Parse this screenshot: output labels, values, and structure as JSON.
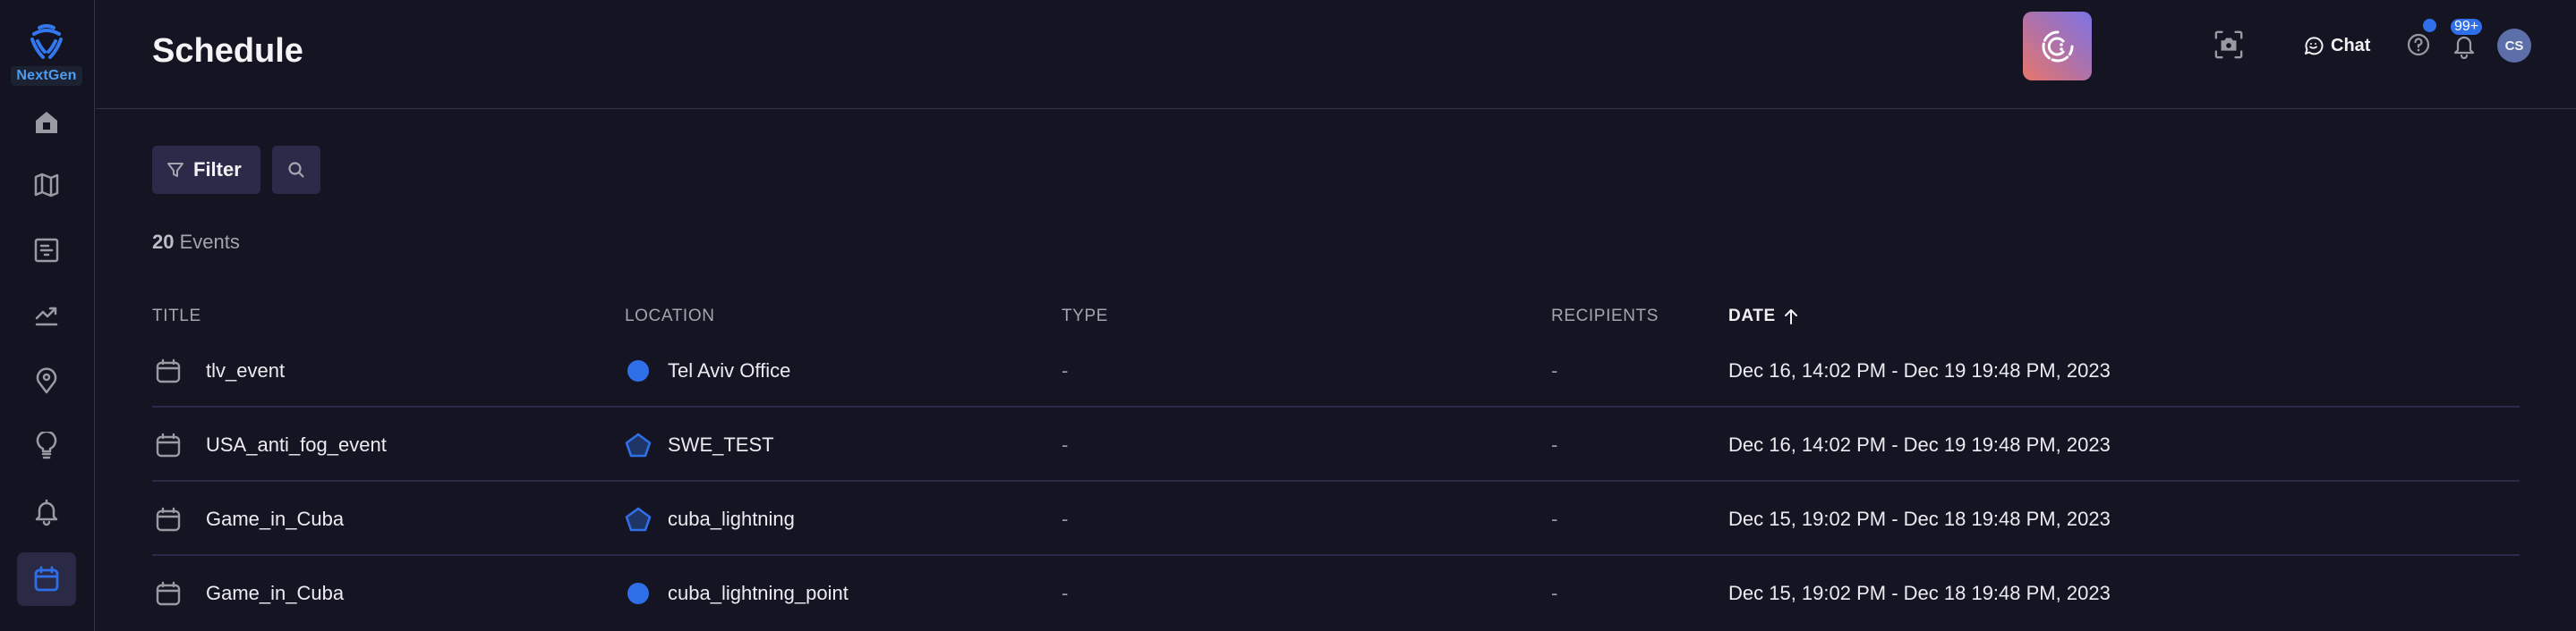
{
  "app": {
    "brand": "NextGen"
  },
  "sidebar": {
    "items": [
      {
        "name": "home",
        "icon": "home-icon",
        "active": false
      },
      {
        "name": "map",
        "icon": "map-icon",
        "active": false
      },
      {
        "name": "reports",
        "icon": "report-icon",
        "active": false
      },
      {
        "name": "analytics",
        "icon": "trend-icon",
        "active": false
      },
      {
        "name": "locations",
        "icon": "location-pin-icon",
        "active": false
      },
      {
        "name": "insights",
        "icon": "lightbulb-icon",
        "active": false
      },
      {
        "name": "alerts",
        "icon": "bell-icon",
        "active": false
      },
      {
        "name": "schedule",
        "icon": "calendar-icon",
        "active": true
      }
    ],
    "active_color": "#2f6fe8"
  },
  "header": {
    "title": "Schedule",
    "chat_label": "Chat",
    "notifications_badge": "99+",
    "avatar_initials": "CS"
  },
  "toolbar": {
    "filter_label": "Filter",
    "count_number": "20",
    "count_label": "Events"
  },
  "table": {
    "columns": [
      {
        "label": "Title"
      },
      {
        "label": "Location"
      },
      {
        "label": "Type"
      },
      {
        "label": "Recipients"
      },
      {
        "label": "Date",
        "sorted": "ascending"
      }
    ],
    "rows": [
      {
        "title": "tlv_event",
        "location": "Tel Aviv Office",
        "location_shape": "point",
        "type": "-",
        "recipients": "-",
        "date": "Dec 16, 14:02 PM - Dec 19 19:48 PM, 2023"
      },
      {
        "title": "USA_anti_fog_event",
        "location": "SWE_TEST",
        "location_shape": "polygon",
        "type": "-",
        "recipients": "-",
        "date": "Dec 16, 14:02 PM - Dec 19 19:48 PM, 2023"
      },
      {
        "title": "Game_in_Cuba",
        "location": "cuba_lightning",
        "location_shape": "polygon",
        "type": "-",
        "recipients": "-",
        "date": "Dec 15, 19:02 PM - Dec 18 19:48 PM, 2023"
      },
      {
        "title": "Game_in_Cuba",
        "location": "cuba_lightning_point",
        "location_shape": "point",
        "type": "-",
        "recipients": "-",
        "date": "Dec 15, 19:02 PM - Dec 18 19:48 PM, 2023"
      }
    ]
  }
}
